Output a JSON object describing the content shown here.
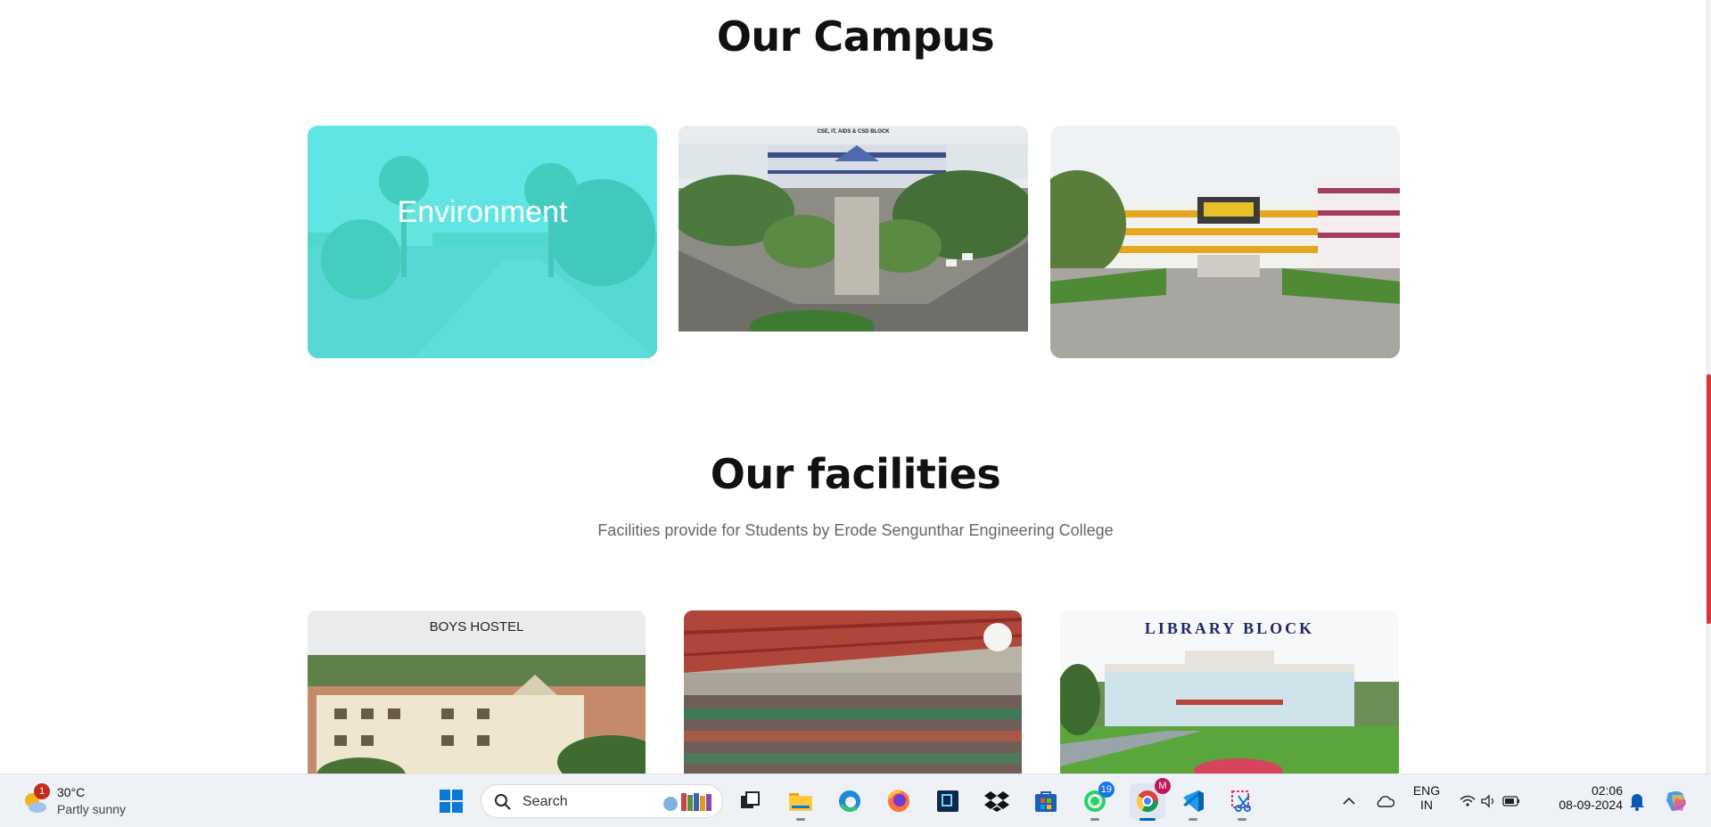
{
  "campus": {
    "title": "Our Campus",
    "cards": [
      {
        "overlay_label": "Environment"
      },
      {
        "caption": "CSE, IT, AIDS & CSD BLOCK"
      },
      {}
    ]
  },
  "facilities": {
    "title": "Our facilities",
    "subtitle": "Facilities provide for Students by Erode Sengunthar Engineering College",
    "cards": [
      {
        "caption": "BOYS HOSTEL"
      },
      {},
      {
        "caption": "LIBRARY BLOCK"
      }
    ]
  },
  "taskbar": {
    "weather": {
      "badge": "1",
      "temp": "30°C",
      "condition": "Partly sunny"
    },
    "search_placeholder": "Search",
    "whatsapp_badge": "19",
    "chrome_profile": "M",
    "language": {
      "line1": "ENG",
      "line2": "IN"
    },
    "clock": {
      "time": "02:06",
      "date": "08-09-2024"
    }
  },
  "colors": {
    "overlay": "#40e4e2",
    "scroll_thumb": "#d9383a",
    "taskbar_bg": "#eef2f7"
  }
}
